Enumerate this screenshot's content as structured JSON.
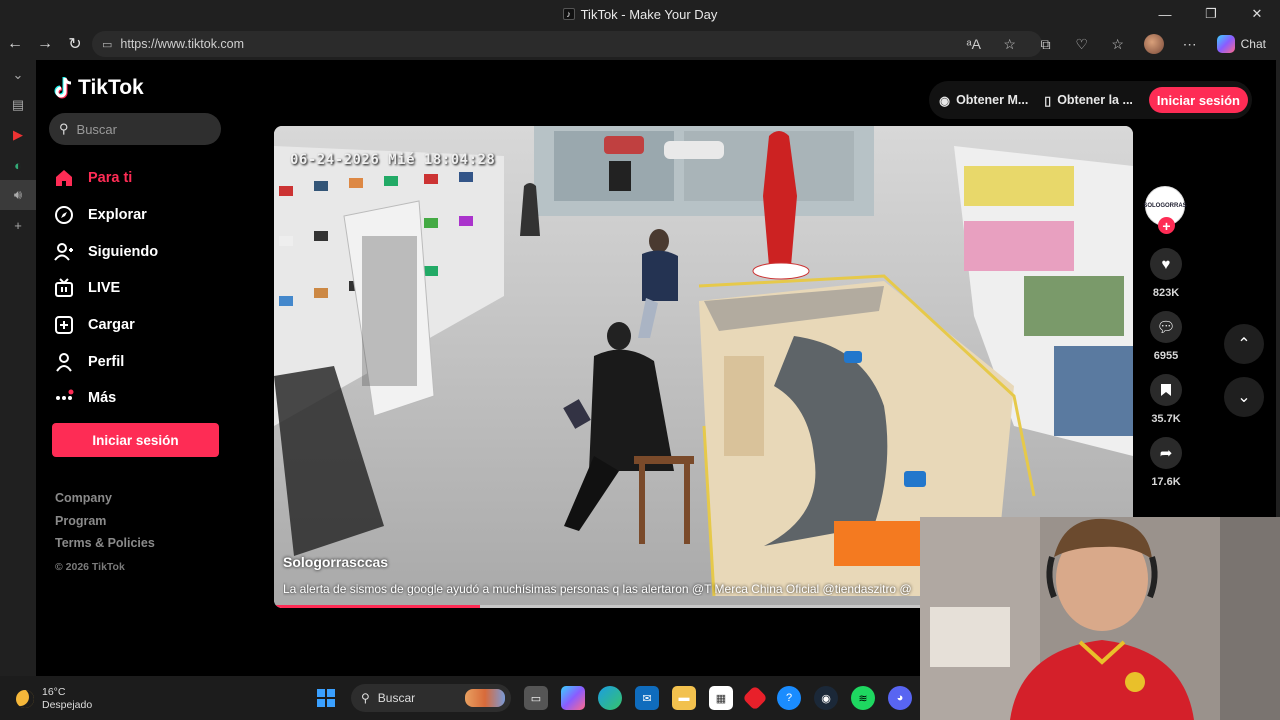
{
  "window": {
    "title": "TikTok - Make Your Day",
    "controls": [
      "—",
      "❐",
      "✕"
    ]
  },
  "browser": {
    "url": "https://www.tiktok.com",
    "chat_label": "Chat",
    "nav": {
      "back": "←",
      "forward": "→",
      "reload": "↻"
    }
  },
  "tiktok": {
    "logo_text": "TikTok",
    "search_placeholder": "Buscar",
    "menu": [
      {
        "label": "Para ti",
        "icon": "home-icon",
        "glyph": "⌂"
      },
      {
        "label": "Explorar",
        "icon": "compass-icon",
        "glyph": "◎"
      },
      {
        "label": "Siguiendo",
        "icon": "following-icon",
        "glyph": "⚇"
      },
      {
        "label": "LIVE",
        "icon": "live-icon",
        "glyph": "▣"
      },
      {
        "label": "Cargar",
        "icon": "upload-icon",
        "glyph": "⊞"
      },
      {
        "label": "Perfil",
        "icon": "profile-icon",
        "glyph": "⚲"
      },
      {
        "label": "Más",
        "icon": "more-icon",
        "glyph": "⋯"
      }
    ],
    "login_label": "Iniciar sesión",
    "footer": [
      "Company",
      "Program",
      "Terms & Policies"
    ],
    "copyright": "© 2026 TikTok",
    "top_actions": {
      "get_coins": "Obtener M...",
      "get_app": "Obtener la ...",
      "login": "Iniciar sesión"
    },
    "video": {
      "timestamp": "06-24-2026 Mié 18:04:28",
      "author": "Sologorrasccas",
      "caption": "La alerta de sismos de google ayudó a muchísimas personas q las alertaron @T Merca China Oficial @tiendaszitro @",
      "progress": 0.24
    },
    "creator_avatar_text": "SOLOGORRAS",
    "actions": {
      "likes": "823K",
      "comments": "6955",
      "saves": "35.7K",
      "shares": "17.6K"
    },
    "nav": {
      "up": "⌃",
      "down": "⌄"
    }
  },
  "taskbar": {
    "temperature": "16°C",
    "weather": "Despejado",
    "search_label": "Buscar"
  },
  "colors": {
    "brand": "#fe2c55",
    "page_bg": "#000000",
    "chrome_bg": "#202020"
  }
}
